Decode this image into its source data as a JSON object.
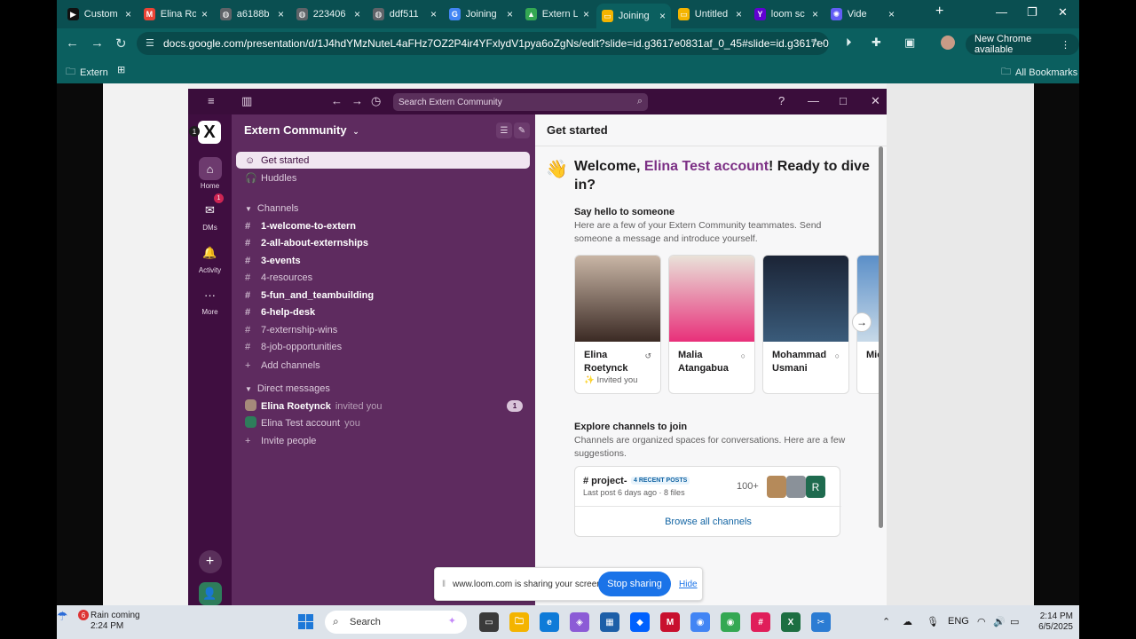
{
  "browser": {
    "tabs": [
      {
        "label": "Custom",
        "icon": "bookmark-tab-icon",
        "color": "#111111",
        "glyph": "▶"
      },
      {
        "label": "Elina Ro",
        "icon": "gmail-tab-icon",
        "color": "#ea4335",
        "glyph": "M"
      },
      {
        "label": "a6188b",
        "icon": "globe-tab-icon",
        "color": "#5f6368",
        "glyph": "◍"
      },
      {
        "label": "223406",
        "icon": "globe-tab-icon",
        "color": "#5f6368",
        "glyph": "◍"
      },
      {
        "label": "ddf511",
        "icon": "globe-tab-icon",
        "color": "#5f6368",
        "glyph": "◍"
      },
      {
        "label": "Joining",
        "icon": "google-tab-icon",
        "color": "#4285f4",
        "glyph": "G"
      },
      {
        "label": "Extern L",
        "icon": "drive-tab-icon",
        "color": "#34a853",
        "glyph": "▲"
      },
      {
        "label": "Joining",
        "icon": "slides-tab-icon",
        "color": "#f4b400",
        "glyph": "▭",
        "active": true
      },
      {
        "label": "Untitled",
        "icon": "slides-tab-icon",
        "color": "#f4b400",
        "glyph": "▭"
      },
      {
        "label": "loom sc",
        "icon": "yahoo-tab-icon",
        "color": "#6001d2",
        "glyph": "Y"
      },
      {
        "label": "Vide",
        "icon": "loom-tab-icon",
        "color": "#625df5",
        "glyph": "✺"
      }
    ],
    "url": "docs.google.com/presentation/d/1J4hdYMzNuteL4aFHz7OZ2P4ir4YFxlydV1pya6oZgNs/edit?slide=id.g3617e0831af_0_45#slide=id.g3617e0831af_0_45",
    "new_chrome": "New Chrome available",
    "bookmarks": {
      "extern": "Extern",
      "all": "All Bookmarks"
    }
  },
  "slack": {
    "search_placeholder": "Search Extern Community",
    "workspace_badge": "1",
    "workspace_logo": "X",
    "rail": [
      {
        "label": "Home",
        "icon": "home-icon",
        "glyph": "⌂"
      },
      {
        "label": "DMs",
        "icon": "dms-icon",
        "glyph": "✉",
        "badge": "1"
      },
      {
        "label": "Activity",
        "icon": "bell-icon",
        "glyph": "🔔"
      },
      {
        "label": "More",
        "icon": "more-icon",
        "glyph": "···"
      }
    ],
    "workspace_name": "Extern Community",
    "get_started": "Get started",
    "huddles": "Huddles",
    "channels_header": "Channels",
    "channels": [
      {
        "name": "1-welcome-to-extern",
        "bold": true
      },
      {
        "name": "2-all-about-externships",
        "bold": true
      },
      {
        "name": "3-events",
        "bold": true
      },
      {
        "name": "4-resources",
        "bold": false
      },
      {
        "name": "5-fun_and_teambuilding",
        "bold": true
      },
      {
        "name": "6-help-desk",
        "bold": true
      },
      {
        "name": "7-externship-wins",
        "bold": false
      },
      {
        "name": "8-job-opportunities",
        "bold": false
      }
    ],
    "add_channels": "Add channels",
    "dm_header": "Direct messages",
    "dms": [
      {
        "name": "Elina Roetynck",
        "note": "invited you",
        "badge": "1",
        "bold": true,
        "avatar_color": "#a58a7a"
      },
      {
        "name": "Elina Test account",
        "note": "you",
        "bold": false,
        "avatar_color": "#2e7d5b"
      }
    ],
    "invite_people": "Invite people",
    "main": {
      "title": "Get started",
      "welcome_prefix": "Welcome, ",
      "welcome_name": "Elina Test account",
      "welcome_suffix": "! Ready to dive in?",
      "say_hello_title": "Say hello to someone",
      "say_hello_text": "Here are a few of your Extern Community teammates. Send someone a message and introduce yourself.",
      "people": [
        {
          "name": "Elina Roetynck",
          "status": "✨ Invited you",
          "colors": [
            "#c9b6a6",
            "#3b2a24"
          ]
        },
        {
          "name": "Malia Atangabua",
          "status": "",
          "colors": [
            "#e9e2d9",
            "#e8307a"
          ]
        },
        {
          "name": "Mohammad Usmani",
          "status": "",
          "colors": [
            "#1b2436",
            "#3a5b7a"
          ]
        },
        {
          "name": "Mic Gu",
          "status": "",
          "colors": [
            "#5b8fc8",
            "#c7d9e8"
          ]
        }
      ],
      "explore_title": "Explore channels to join",
      "explore_text": "Channels are organized spaces for conversations. Here are a few suggestions.",
      "suggested_channel": {
        "name": "# project-",
        "tag": "4 RECENT POSTS",
        "meta": "Last post 6 days ago · 8 files",
        "members": "100+",
        "member_letter": "R"
      },
      "browse_all": "Browse all channels"
    }
  },
  "share_banner": {
    "text": "www.loom.com is sharing your screen.",
    "stop": "Stop sharing",
    "hide": "Hide"
  },
  "taskbar": {
    "weather_badge": "6",
    "weather_line1": "Rain coming",
    "weather_line2": "2:24 PM",
    "search": "Search",
    "lang": "ENG",
    "time": "2:14 PM",
    "date": "6/5/2025"
  }
}
